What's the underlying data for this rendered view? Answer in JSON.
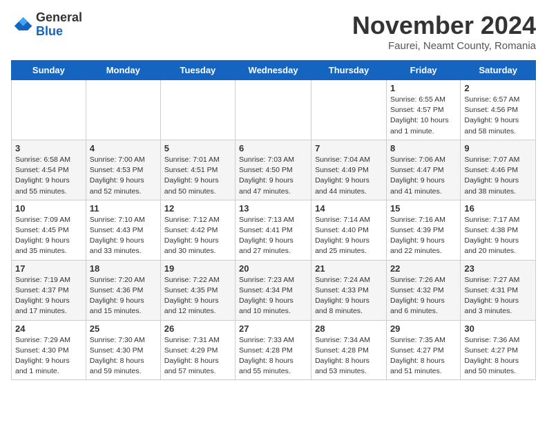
{
  "header": {
    "logo_general": "General",
    "logo_blue": "Blue",
    "month_title": "November 2024",
    "location": "Faurei, Neamt County, Romania"
  },
  "days_of_week": [
    "Sunday",
    "Monday",
    "Tuesday",
    "Wednesday",
    "Thursday",
    "Friday",
    "Saturday"
  ],
  "weeks": [
    [
      {
        "day": "",
        "info": ""
      },
      {
        "day": "",
        "info": ""
      },
      {
        "day": "",
        "info": ""
      },
      {
        "day": "",
        "info": ""
      },
      {
        "day": "",
        "info": ""
      },
      {
        "day": "1",
        "info": "Sunrise: 6:55 AM\nSunset: 4:57 PM\nDaylight: 10 hours and 1 minute."
      },
      {
        "day": "2",
        "info": "Sunrise: 6:57 AM\nSunset: 4:56 PM\nDaylight: 9 hours and 58 minutes."
      }
    ],
    [
      {
        "day": "3",
        "info": "Sunrise: 6:58 AM\nSunset: 4:54 PM\nDaylight: 9 hours and 55 minutes."
      },
      {
        "day": "4",
        "info": "Sunrise: 7:00 AM\nSunset: 4:53 PM\nDaylight: 9 hours and 52 minutes."
      },
      {
        "day": "5",
        "info": "Sunrise: 7:01 AM\nSunset: 4:51 PM\nDaylight: 9 hours and 50 minutes."
      },
      {
        "day": "6",
        "info": "Sunrise: 7:03 AM\nSunset: 4:50 PM\nDaylight: 9 hours and 47 minutes."
      },
      {
        "day": "7",
        "info": "Sunrise: 7:04 AM\nSunset: 4:49 PM\nDaylight: 9 hours and 44 minutes."
      },
      {
        "day": "8",
        "info": "Sunrise: 7:06 AM\nSunset: 4:47 PM\nDaylight: 9 hours and 41 minutes."
      },
      {
        "day": "9",
        "info": "Sunrise: 7:07 AM\nSunset: 4:46 PM\nDaylight: 9 hours and 38 minutes."
      }
    ],
    [
      {
        "day": "10",
        "info": "Sunrise: 7:09 AM\nSunset: 4:45 PM\nDaylight: 9 hours and 35 minutes."
      },
      {
        "day": "11",
        "info": "Sunrise: 7:10 AM\nSunset: 4:43 PM\nDaylight: 9 hours and 33 minutes."
      },
      {
        "day": "12",
        "info": "Sunrise: 7:12 AM\nSunset: 4:42 PM\nDaylight: 9 hours and 30 minutes."
      },
      {
        "day": "13",
        "info": "Sunrise: 7:13 AM\nSunset: 4:41 PM\nDaylight: 9 hours and 27 minutes."
      },
      {
        "day": "14",
        "info": "Sunrise: 7:14 AM\nSunset: 4:40 PM\nDaylight: 9 hours and 25 minutes."
      },
      {
        "day": "15",
        "info": "Sunrise: 7:16 AM\nSunset: 4:39 PM\nDaylight: 9 hours and 22 minutes."
      },
      {
        "day": "16",
        "info": "Sunrise: 7:17 AM\nSunset: 4:38 PM\nDaylight: 9 hours and 20 minutes."
      }
    ],
    [
      {
        "day": "17",
        "info": "Sunrise: 7:19 AM\nSunset: 4:37 PM\nDaylight: 9 hours and 17 minutes."
      },
      {
        "day": "18",
        "info": "Sunrise: 7:20 AM\nSunset: 4:36 PM\nDaylight: 9 hours and 15 minutes."
      },
      {
        "day": "19",
        "info": "Sunrise: 7:22 AM\nSunset: 4:35 PM\nDaylight: 9 hours and 12 minutes."
      },
      {
        "day": "20",
        "info": "Sunrise: 7:23 AM\nSunset: 4:34 PM\nDaylight: 9 hours and 10 minutes."
      },
      {
        "day": "21",
        "info": "Sunrise: 7:24 AM\nSunset: 4:33 PM\nDaylight: 9 hours and 8 minutes."
      },
      {
        "day": "22",
        "info": "Sunrise: 7:26 AM\nSunset: 4:32 PM\nDaylight: 9 hours and 6 minutes."
      },
      {
        "day": "23",
        "info": "Sunrise: 7:27 AM\nSunset: 4:31 PM\nDaylight: 9 hours and 3 minutes."
      }
    ],
    [
      {
        "day": "24",
        "info": "Sunrise: 7:29 AM\nSunset: 4:30 PM\nDaylight: 9 hours and 1 minute."
      },
      {
        "day": "25",
        "info": "Sunrise: 7:30 AM\nSunset: 4:30 PM\nDaylight: 8 hours and 59 minutes."
      },
      {
        "day": "26",
        "info": "Sunrise: 7:31 AM\nSunset: 4:29 PM\nDaylight: 8 hours and 57 minutes."
      },
      {
        "day": "27",
        "info": "Sunrise: 7:33 AM\nSunset: 4:28 PM\nDaylight: 8 hours and 55 minutes."
      },
      {
        "day": "28",
        "info": "Sunrise: 7:34 AM\nSunset: 4:28 PM\nDaylight: 8 hours and 53 minutes."
      },
      {
        "day": "29",
        "info": "Sunrise: 7:35 AM\nSunset: 4:27 PM\nDaylight: 8 hours and 51 minutes."
      },
      {
        "day": "30",
        "info": "Sunrise: 7:36 AM\nSunset: 4:27 PM\nDaylight: 8 hours and 50 minutes."
      }
    ]
  ]
}
